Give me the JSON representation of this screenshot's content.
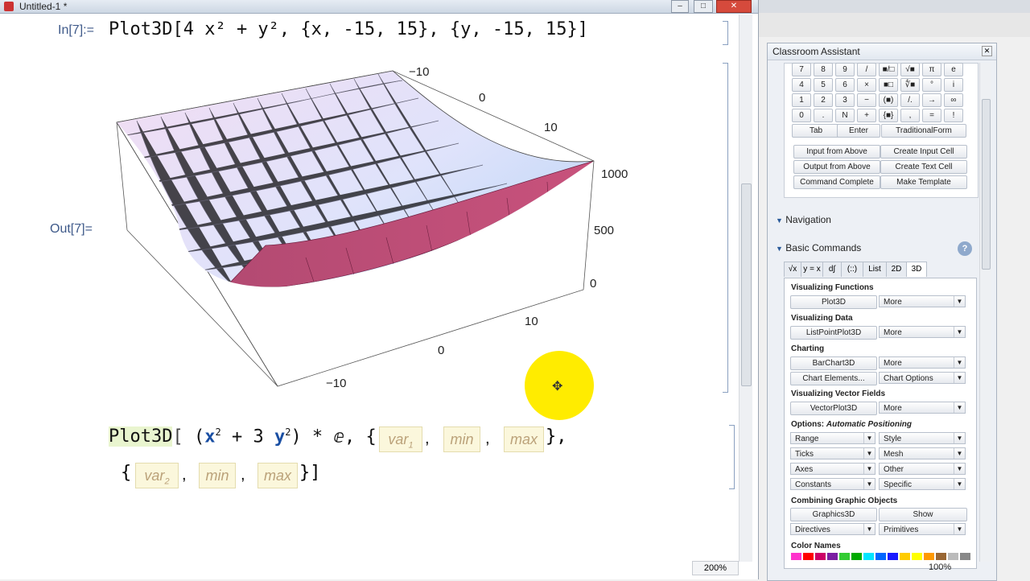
{
  "notebook": {
    "title": "Untitled-1 *",
    "in_label": "In[7]:=",
    "out_label": "Out[7]=",
    "input_line": "Plot3D[4 x² + y², {x, -15, 15}, {y, -15, 15}]",
    "zoom": "200%",
    "template": {
      "head": "Plot3D",
      "expr_open": "(",
      "expr_x": "x",
      "expr_sup1": "2",
      "expr_mid": " + 3 ",
      "expr_y": "y",
      "expr_sup2": "2",
      "expr_close": ") * ⅇ, {",
      "var1": "var",
      "var1_sub": "1",
      "min": "min",
      "max": "max",
      "close1": "},",
      "open2": "{",
      "var2": "var",
      "var2_sub": "2",
      "close2": "}]"
    },
    "plot_ticks": {
      "back_y": [
        "−10",
        "0",
        "10"
      ],
      "z": [
        "1000",
        "500",
        "0"
      ],
      "front_x": [
        "−10",
        "0",
        "10"
      ]
    },
    "window_controls": [
      "–",
      "□",
      "✕"
    ]
  },
  "palette": {
    "title": "Classroom Assistant",
    "zoom": "100%",
    "keypad": [
      [
        "7",
        "8",
        "9",
        "/",
        "■/□",
        "√■",
        "π",
        "e"
      ],
      [
        "4",
        "5",
        "6",
        "×",
        "■□",
        "∜■",
        "°",
        "i"
      ],
      [
        "1",
        "2",
        "3",
        "−",
        "(■)",
        "/.",
        "→",
        "∞"
      ],
      [
        "0",
        ".",
        "N",
        "+",
        "{■}",
        ",",
        "=",
        "!"
      ]
    ],
    "keypad_row5": [
      "Tab",
      "Enter",
      "TraditionalForm"
    ],
    "cell_buttons": [
      "Input from Above",
      "Create Input Cell",
      "Output from Above",
      "Create Text Cell",
      "Command Complete",
      "Make Template"
    ],
    "navigation": "Navigation",
    "basic_commands": "Basic Commands",
    "help": "?",
    "tabs": [
      "√x",
      "y = x",
      "d∫",
      "(::)",
      "List",
      "2D",
      "3D"
    ],
    "sections": {
      "vis_functions": "Visualizing Functions",
      "plot3d": "Plot3D",
      "more": "More",
      "vis_data": "Visualizing Data",
      "listpointplot3d": "ListPointPlot3D",
      "charting": "Charting",
      "barchart3d": "BarChart3D",
      "chart_elements": "Chart Elements...",
      "chart_options": "Chart Options",
      "vis_vector": "Visualizing Vector Fields",
      "vectorplot3d": "VectorPlot3D",
      "options": "Options:",
      "options_mode": "Automatic Positioning",
      "range": "Range",
      "style": "Style",
      "ticks": "Ticks",
      "mesh": "Mesh",
      "axes": "Axes",
      "other": "Other",
      "constants": "Constants",
      "specific": "Specific",
      "combining": "Combining Graphic Objects",
      "graphics3d": "Graphics3D",
      "show": "Show",
      "directives": "Directives",
      "primitives": "Primitives",
      "color_names": "Color Names"
    },
    "swatches": [
      "#ff33cc",
      "#ff0000",
      "#cc0066",
      "#7a1fa2",
      "#33cc33",
      "#00aa00",
      "#00e5ff",
      "#0066ff",
      "#1a1aff",
      "#ffcc00",
      "#ffff00",
      "#ff9900",
      "#996633",
      "#bbbbbb",
      "#888888"
    ]
  },
  "colors": {
    "keyword_blue": "#1a4fa3",
    "cursor_highlight": "#ffe600"
  }
}
